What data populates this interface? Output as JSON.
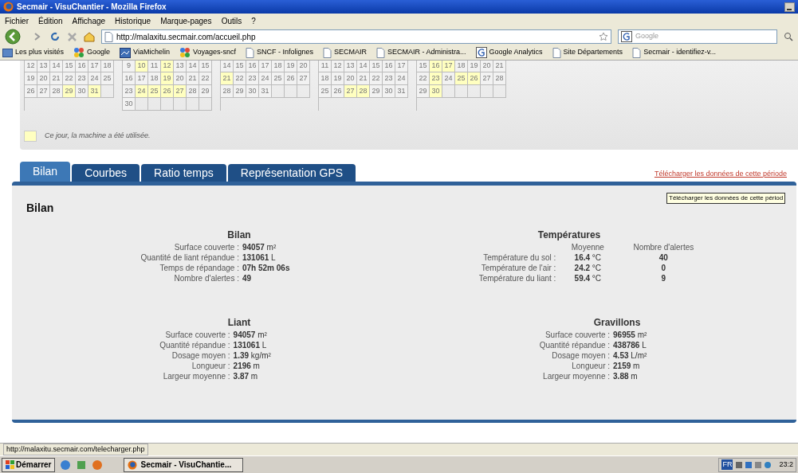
{
  "window": {
    "title": "Secmair - VisuChantier - Mozilla Firefox"
  },
  "menu": [
    "Fichier",
    "Édition",
    "Affichage",
    "Historique",
    "Marque-pages",
    "Outils",
    "?"
  ],
  "address_bar": {
    "value": "http://malaxitu.secmair.com/accueil.php"
  },
  "search": {
    "placeholder": "Google"
  },
  "bookmarks": [
    {
      "label": "Les plus visités",
      "kind": "folder"
    },
    {
      "label": "Google",
      "kind": "colors"
    },
    {
      "label": "ViaMichelin",
      "kind": "map"
    },
    {
      "label": "Voyages-sncf",
      "kind": "colors"
    },
    {
      "label": "SNCF - Infolignes",
      "kind": "page"
    },
    {
      "label": "SECMAIR",
      "kind": "page"
    },
    {
      "label": "SECMAIR - Administra...",
      "kind": "page"
    },
    {
      "label": "Google Analytics",
      "kind": "g"
    },
    {
      "label": "Site Départements",
      "kind": "page"
    },
    {
      "label": "Secmair - identifiez-v...",
      "kind": "page"
    }
  ],
  "calendars": [
    {
      "weeks": [
        [
          {
            "day": "12",
            "used": false
          },
          {
            "day": "13",
            "used": false
          },
          {
            "day": "14",
            "used": false
          },
          {
            "day": "15",
            "used": false
          },
          {
            "day": "16",
            "used": false
          },
          {
            "day": "17",
            "used": false
          },
          {
            "day": "18",
            "used": false
          }
        ],
        [
          {
            "day": "19",
            "used": false
          },
          {
            "day": "20",
            "used": false
          },
          {
            "day": "21",
            "used": false
          },
          {
            "day": "22",
            "used": false
          },
          {
            "day": "23",
            "used": false
          },
          {
            "day": "24",
            "used": false
          },
          {
            "day": "25",
            "used": false
          }
        ],
        [
          {
            "day": "26",
            "used": false
          },
          {
            "day": "27",
            "used": false
          },
          {
            "day": "28",
            "used": false
          },
          {
            "day": "29",
            "used": true
          },
          {
            "day": "30",
            "used": false
          },
          {
            "day": "31",
            "used": true
          }
        ]
      ]
    },
    {
      "weeks": [
        [
          {
            "day": "9",
            "used": false
          },
          {
            "day": "10",
            "used": true
          },
          {
            "day": "11",
            "used": false
          },
          {
            "day": "12",
            "used": true
          },
          {
            "day": "13",
            "used": false
          },
          {
            "day": "14",
            "used": false
          },
          {
            "day": "15",
            "used": false
          }
        ],
        [
          {
            "day": "16",
            "used": false
          },
          {
            "day": "17",
            "used": false
          },
          {
            "day": "18",
            "used": false
          },
          {
            "day": "19",
            "used": true
          },
          {
            "day": "20",
            "used": false
          },
          {
            "day": "21",
            "used": false
          },
          {
            "day": "22",
            "used": false
          }
        ],
        [
          {
            "day": "23",
            "used": false
          },
          {
            "day": "24",
            "used": true
          },
          {
            "day": "25",
            "used": true
          },
          {
            "day": "26",
            "used": true
          },
          {
            "day": "27",
            "used": true
          },
          {
            "day": "28",
            "used": false
          },
          {
            "day": "29",
            "used": false
          }
        ],
        [
          {
            "day": "30",
            "used": false
          }
        ]
      ]
    },
    {
      "weeks": [
        [
          {
            "day": "14",
            "used": false
          },
          {
            "day": "15",
            "used": false
          },
          {
            "day": "16",
            "used": false
          },
          {
            "day": "17",
            "used": false
          },
          {
            "day": "18",
            "used": false
          },
          {
            "day": "19",
            "used": false
          },
          {
            "day": "20",
            "used": false
          }
        ],
        [
          {
            "day": "21",
            "used": true
          },
          {
            "day": "22",
            "used": false
          },
          {
            "day": "23",
            "used": false
          },
          {
            "day": "24",
            "used": false
          },
          {
            "day": "25",
            "used": false
          },
          {
            "day": "26",
            "used": false
          },
          {
            "day": "27",
            "used": false
          }
        ],
        [
          {
            "day": "28",
            "used": false
          },
          {
            "day": "29",
            "used": false
          },
          {
            "day": "30",
            "used": false
          },
          {
            "day": "31",
            "used": false
          }
        ]
      ]
    },
    {
      "weeks": [
        [
          {
            "day": "11",
            "used": false
          },
          {
            "day": "12",
            "used": false
          },
          {
            "day": "13",
            "used": false
          },
          {
            "day": "14",
            "used": false
          },
          {
            "day": "15",
            "used": false
          },
          {
            "day": "16",
            "used": false
          },
          {
            "day": "17",
            "used": false
          }
        ],
        [
          {
            "day": "18",
            "used": false
          },
          {
            "day": "19",
            "used": false
          },
          {
            "day": "20",
            "used": false
          },
          {
            "day": "21",
            "used": false
          },
          {
            "day": "22",
            "used": false
          },
          {
            "day": "23",
            "used": false
          },
          {
            "day": "24",
            "used": false
          }
        ],
        [
          {
            "day": "25",
            "used": false
          },
          {
            "day": "26",
            "used": false
          },
          {
            "day": "27",
            "used": true
          },
          {
            "day": "28",
            "used": true
          },
          {
            "day": "29",
            "used": false
          },
          {
            "day": "30",
            "used": false
          },
          {
            "day": "31",
            "used": false
          }
        ]
      ]
    },
    {
      "weeks": [
        [
          {
            "day": "15",
            "used": false
          },
          {
            "day": "16",
            "used": true
          },
          {
            "day": "17",
            "used": true
          },
          {
            "day": "18",
            "used": false
          },
          {
            "day": "19",
            "used": false
          },
          {
            "day": "20",
            "used": false
          },
          {
            "day": "21",
            "used": false
          }
        ],
        [
          {
            "day": "22",
            "used": false
          },
          {
            "day": "23",
            "used": true
          },
          {
            "day": "24",
            "used": false
          },
          {
            "day": "25",
            "used": true
          },
          {
            "day": "26",
            "used": true
          },
          {
            "day": "27",
            "used": false
          },
          {
            "day": "28",
            "used": false
          }
        ],
        [
          {
            "day": "29",
            "used": false
          },
          {
            "day": "30",
            "used": true
          }
        ]
      ]
    }
  ],
  "legend": "Ce jour, la machine a été utilisée.",
  "tabs": [
    {
      "label": "Bilan",
      "selected": true
    },
    {
      "label": "Courbes",
      "selected": false
    },
    {
      "label": "Ratio temps",
      "selected": false
    },
    {
      "label": "Représentation GPS",
      "selected": false
    }
  ],
  "download_link": "Télécharger les données de cette période",
  "tooltip": "Télécharger les données de cette périod",
  "panel_title": "Bilan",
  "bilan": {
    "title": "Bilan",
    "rows": [
      {
        "label": "Surface couverte :",
        "value": "94057",
        "unit": "m²"
      },
      {
        "label": "Quantité de liant répandue :",
        "value": "131061",
        "unit": "L"
      },
      {
        "label": "Temps de répandage :",
        "value": "07h 52m 06s",
        "unit": ""
      },
      {
        "label": "Nombre d'alertes :",
        "value": "49",
        "unit": ""
      }
    ]
  },
  "temperatures": {
    "title": "Températures",
    "columns": [
      "Moyenne",
      "Nombre d'alertes"
    ],
    "rows": [
      {
        "label": "Température du sol :",
        "value": "16.4",
        "unit": "°C",
        "alerts": "40"
      },
      {
        "label": "Température de l'air :",
        "value": "24.2",
        "unit": "°C",
        "alerts": "0"
      },
      {
        "label": "Température du liant :",
        "value": "59.4",
        "unit": "°C",
        "alerts": "9"
      }
    ]
  },
  "liant": {
    "title": "Liant",
    "rows": [
      {
        "label": "Surface couverte :",
        "value": "94057",
        "unit": "m²"
      },
      {
        "label": "Quantité répandue :",
        "value": "131061",
        "unit": "L"
      },
      {
        "label": "Dosage moyen :",
        "value": "1.39",
        "unit": "kg/m²"
      },
      {
        "label": "Longueur :",
        "value": "2196",
        "unit": "m"
      },
      {
        "label": "Largeur moyenne :",
        "value": "3.87",
        "unit": "m"
      }
    ]
  },
  "gravillons": {
    "title": "Gravillons",
    "rows": [
      {
        "label": "Surface couverte :",
        "value": "96955",
        "unit": "m²"
      },
      {
        "label": "Quantité répandue :",
        "value": "438786",
        "unit": "L"
      },
      {
        "label": "Dosage moyen :",
        "value": "4.53",
        "unit": "L/m²"
      },
      {
        "label": "Longueur :",
        "value": "2159",
        "unit": "m"
      },
      {
        "label": "Largeur moyenne :",
        "value": "3.88",
        "unit": "m"
      }
    ]
  },
  "status_bar": "http://malaxitu.secmair.com/telecharger.php",
  "taskbar": {
    "start": "Démarrer",
    "task": "Secmair - VisuChantie...",
    "language": "FR",
    "clock": "23:2"
  }
}
